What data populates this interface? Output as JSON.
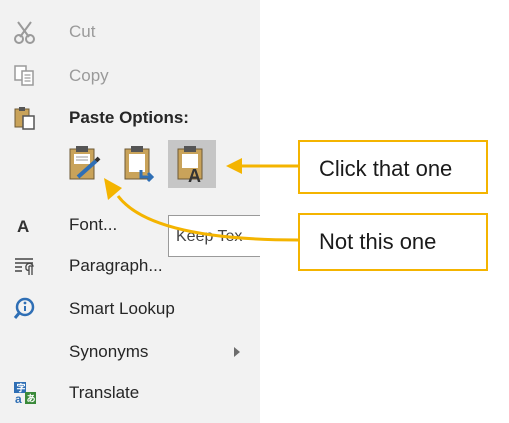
{
  "menu": {
    "cut_label": "Cut",
    "copy_label": "Copy",
    "paste_options_label": "Paste Options:",
    "font_label": "Font...",
    "paragraph_label": "Paragraph...",
    "smart_lookup_label": "Smart Lookup",
    "synonyms_label": "Synonyms",
    "translate_label": "Translate"
  },
  "tooltip": {
    "text": "Keep Tex"
  },
  "callouts": {
    "click_label": "Click that one",
    "not_label": "Not this one"
  },
  "colors": {
    "accent": "#f4b400",
    "menu_bg": "#f2f2f2",
    "selected_bg": "#c6c6c6",
    "icon_blue": "#2f6fb5",
    "clipboard_gold": "#c9a35a"
  },
  "icons": {
    "cut": "scissors-icon",
    "copy": "copy-icon",
    "paste": "paste-icon",
    "font": "font-icon",
    "paragraph": "paragraph-icon",
    "smart_lookup": "lookup-icon",
    "translate": "translate-icon"
  }
}
